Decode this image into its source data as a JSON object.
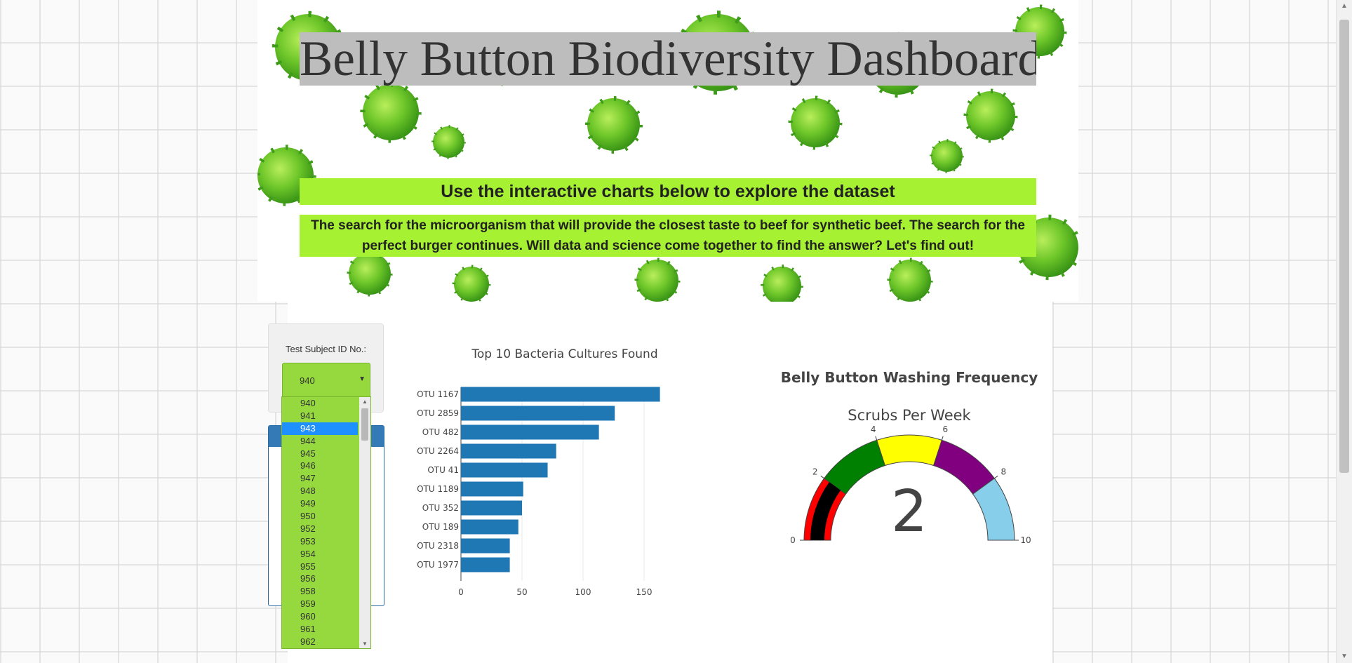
{
  "header": {
    "title": "Belly Button Biodiversity Dashboard",
    "subtitle": "Use the interactive charts below to explore the dataset",
    "description": "The search for the microorganism that will provide the closest taste to beef for synthetic beef. The search for the perfect burger continues. Will data and science come together to find the answer? Let's find out!"
  },
  "selector": {
    "label": "Test Subject ID No.:",
    "value": "940",
    "options": [
      "940",
      "941",
      "943",
      "944",
      "945",
      "946",
      "947",
      "948",
      "949",
      "950",
      "952",
      "953",
      "954",
      "955",
      "956",
      "958",
      "959",
      "960",
      "961",
      "962"
    ],
    "highlighted": "943"
  },
  "colors": {
    "title_bg": "#bdbdbd",
    "subtitle_bg": "#a6f232",
    "select_bg": "#95d93f",
    "highlight": "#1e90ff",
    "panel_header": "#337ab7",
    "bar": "#1f77b4"
  },
  "chart_data": [
    {
      "type": "bar",
      "orientation": "horizontal",
      "title": "Top 10 Bacteria Cultures Found",
      "categories": [
        "OTU 1167",
        "OTU 2859",
        "OTU 482",
        "OTU 2264",
        "OTU 41",
        "OTU 1189",
        "OTU 352",
        "OTU 189",
        "OTU 2318",
        "OTU 1977"
      ],
      "values": [
        163,
        126,
        113,
        78,
        71,
        51,
        50,
        47,
        40,
        40
      ],
      "xticks": [
        0,
        50,
        100,
        150
      ],
      "xlim": [
        0,
        165
      ]
    },
    {
      "type": "gauge",
      "title": "Belly Button Washing Frequency",
      "subtitle": "Scrubs Per Week",
      "value": 2,
      "range": [
        0,
        10
      ],
      "ticks": [
        0,
        2,
        4,
        6,
        8,
        10
      ],
      "bands": [
        {
          "from": 0,
          "to": 2,
          "color": "#ff0000"
        },
        {
          "from": 2,
          "to": 4,
          "color": "#008000"
        },
        {
          "from": 4,
          "to": 6,
          "color": "#ffff00"
        },
        {
          "from": 6,
          "to": 8,
          "color": "#800080"
        },
        {
          "from": 8,
          "to": 10,
          "color": "#87ceeb"
        }
      ],
      "bar_color": "#000000"
    }
  ]
}
